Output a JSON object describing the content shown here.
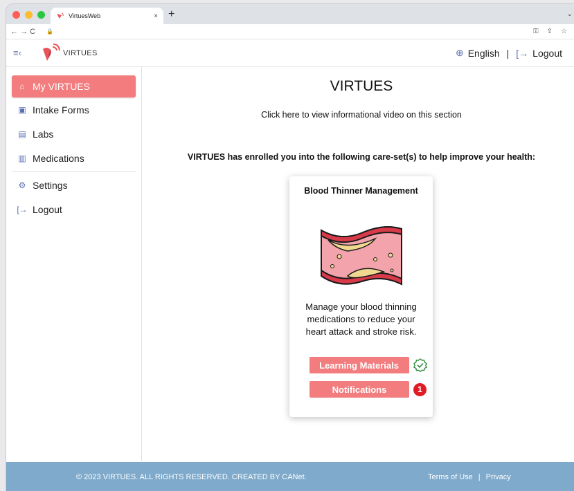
{
  "browser": {
    "tab_title": "VirtuesWeb",
    "tab_close": "×",
    "new_tab": "+",
    "tab_menu": "⌄",
    "nav": "←  →  C"
  },
  "header": {
    "brand_name": "VIRTUES",
    "language": "English",
    "separator": "|",
    "logout": "Logout"
  },
  "sidebar": {
    "items": [
      {
        "label": "My VIRTUES",
        "icon": "home-icon",
        "active": true
      },
      {
        "label": "Intake Forms",
        "icon": "clipboard-icon"
      },
      {
        "label": "Labs",
        "icon": "document-icon"
      },
      {
        "label": "Medications",
        "icon": "medication-list-icon"
      },
      {
        "label": "Settings",
        "icon": "gear-icon"
      },
      {
        "label": "Logout",
        "icon": "logout-icon"
      }
    ]
  },
  "main": {
    "title": "VIRTUES",
    "video_link": "Click here to view informational video on this section",
    "enroll_text": "VIRTUES has enrolled you into the following care-set(s) to help improve your health:"
  },
  "card": {
    "title": "Blood Thinner Management",
    "description": "Manage your blood thinning medications to reduce your heart attack and stroke risk.",
    "learning_button": "Learning Materials",
    "notifications_button": "Notifications",
    "notification_count": "1"
  },
  "footer": {
    "copyright": "© 2023 VIRTUES. ALL RIGHTS RESERVED. CREATED BY CANet.",
    "terms": "Terms of Use",
    "separator": "|",
    "privacy": "Privacy"
  },
  "colors": {
    "accent": "#f27c7e",
    "footer": "#7faacb",
    "badge": "#e01b24",
    "check": "#2e8b3a"
  }
}
